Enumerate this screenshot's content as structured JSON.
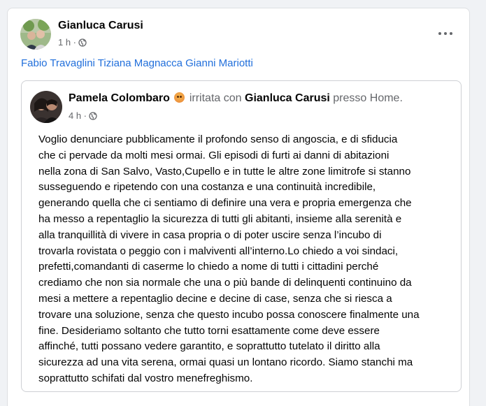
{
  "post": {
    "author": "Gianluca Carusi",
    "time": "1 h ·",
    "tagged": [
      "Fabio Travaglini",
      "Tiziana Magnacca",
      "Gianni Mariotti"
    ]
  },
  "shared": {
    "author": "Pamela Colombaro",
    "feeling": "irritata con",
    "with": "Gianluca Carusi",
    "location_prefix": "presso",
    "location": "Home.",
    "time": "4 h ·",
    "text_lines": [
      "Voglio denunciare pubblicamente il profondo senso di angoscia, e di sfiducia",
      "che ci pervade da molti mesi ormai. Gli episodi di furti ai danni di abitazioni",
      "nella zona di San Salvo, Vasto,Cupello e in tutte le altre zone limitrofe si stanno",
      "susseguendo e ripetendo con una costanza e una continuità incredibile,",
      "generando quella che ci sentiamo di definire una vera e propria emergenza che",
      "ha messo a repentaglio la sicurezza di tutti gli abitanti, insieme alla serenità e",
      "alla tranquillità di vivere in casa propria o di poter uscire senza l’incubo di",
      "trovarla rovistata o peggio con i malviventi all’interno.Lo chiedo a voi sindaci,",
      "prefetti,comandanti di caserme lo chiedo a nome di tutti i cittadini perché",
      "crediamo che non sia normale che una o più bande di delinquenti continuino da",
      "mesi a mettere a repentaglio decine e decine di case, senza che si riesca a",
      "trovare una soluzione, senza che questo incubo possa conoscere finalmente una",
      "fine. Desideriamo soltanto che tutto torni esattamente come deve essere",
      "affinché, tutti possano vedere garantito, e soprattutto tutelato il diritto alla",
      "sicurezza ad una vita serena, ormai quasi un lontano ricordo. Siamo stanchi ma",
      "soprattutto schifati dal vostro menefreghismo."
    ]
  }
}
